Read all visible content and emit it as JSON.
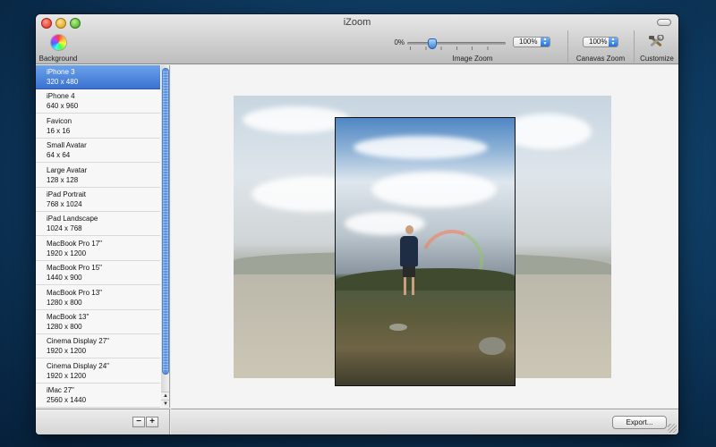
{
  "window": {
    "title": "iZoom"
  },
  "toolbar": {
    "background_label": "Background",
    "zoom_min_label": "0%",
    "image_zoom_value": "100%",
    "image_zoom_label": "Image Zoom",
    "image_zoom_slider_level": 0.25,
    "canvas_zoom_value": "100%",
    "canvas_zoom_label": "Canavas Zoom",
    "customize_label": "Customize"
  },
  "sidebar": {
    "selected_index": 0,
    "items": [
      {
        "name": "iPhone 3",
        "size": "320 x 480"
      },
      {
        "name": "iPhone 4",
        "size": "640 x 960"
      },
      {
        "name": "Favicon",
        "size": "16 x 16"
      },
      {
        "name": "Small Avatar",
        "size": "64 x 64"
      },
      {
        "name": "Large Avatar",
        "size": "128 x 128"
      },
      {
        "name": "iPad Portrait",
        "size": "768 x 1024"
      },
      {
        "name": "iPad Landscape",
        "size": "1024 x 768"
      },
      {
        "name": "MacBook Pro 17\"",
        "size": "1920 x 1200"
      },
      {
        "name": "MacBook Pro 15\"",
        "size": "1440 x 900"
      },
      {
        "name": "MacBook Pro 13\"",
        "size": "1280 x 800"
      },
      {
        "name": "MacBook 13\"",
        "size": "1280 x 800"
      },
      {
        "name": "Cinema Display 27\"",
        "size": "1920 x 1200"
      },
      {
        "name": "Cinema Display 24\"",
        "size": "1920 x 1200"
      },
      {
        "name": "iMac 27\"",
        "size": "2560 x 1440"
      }
    ]
  },
  "bottom": {
    "remove_label": "−",
    "add_label": "+",
    "export_label": "Export..."
  },
  "colors": {
    "selection": "#3b72d2",
    "scrollbar": "#4f8be0"
  }
}
